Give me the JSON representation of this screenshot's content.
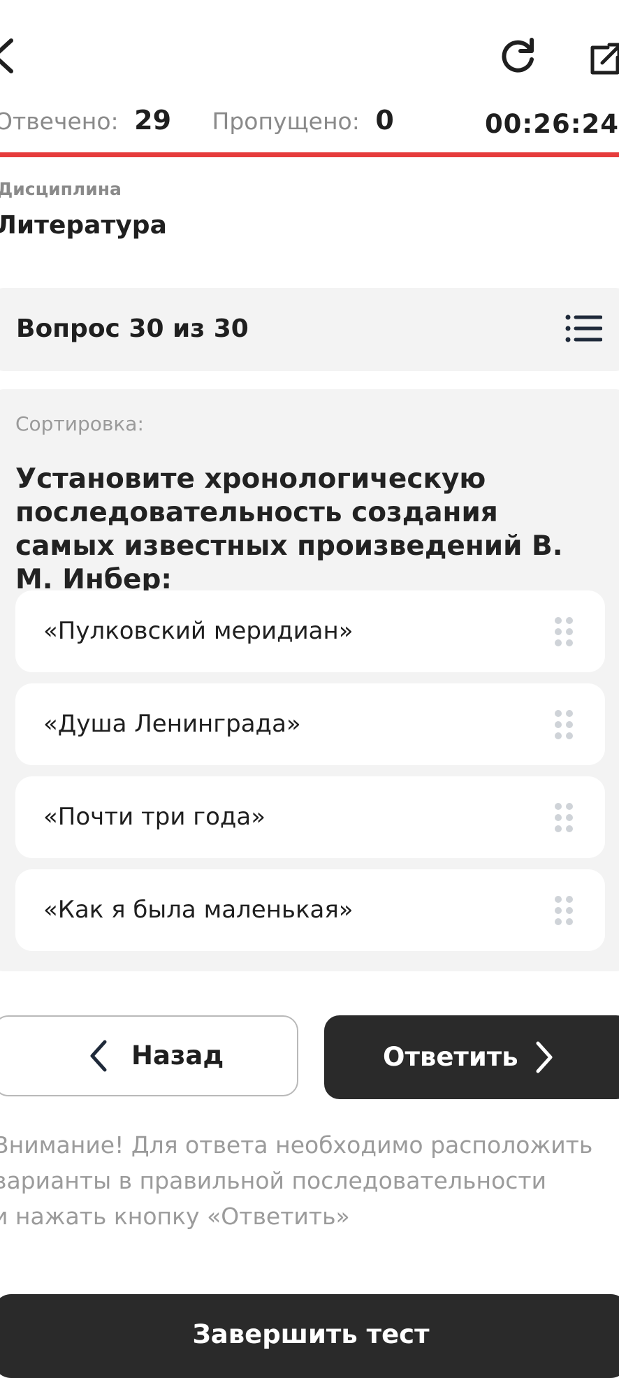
{
  "header": {
    "back_icon": "chevron-left-icon",
    "reload_icon": "reload-icon",
    "external_icon": "external-link-icon"
  },
  "stats": {
    "answered_label": "Отвечено:",
    "answered_value": "29",
    "skipped_label": "Пропущено:",
    "skipped_value": "0",
    "timer": "00:26:24"
  },
  "progress": {
    "fraction": 1.0,
    "color": "#e63c3c"
  },
  "discipline": {
    "label": "Дисциплина",
    "value": "Литература"
  },
  "question_header": {
    "title": "Вопрос 30 из 30",
    "list_icon": "list-icon"
  },
  "question": {
    "type_label": "Сортировка:",
    "text": "Установите хронологическую последовательность создания самых известных произведений В. М. Инбер:",
    "options": [
      "«Пулковский меридиан»",
      "«Душа Ленинграда»",
      "«Почти три года»",
      "«Как я была маленькая»"
    ],
    "drag_icon": "drag-handle-icon"
  },
  "actions": {
    "back_label": "Назад",
    "answer_label": "Ответить"
  },
  "notice": {
    "text": "Внимание! Для ответа необходимо расположить\nварианты в правильной последовательности\nи нажать кнопку «Ответить»"
  },
  "footer": {
    "finish_label": "Завершить тест"
  },
  "colors": {
    "accent": "#e63c3c",
    "dark_button": "#2a2a2a",
    "card_bg": "#f3f3f3"
  }
}
